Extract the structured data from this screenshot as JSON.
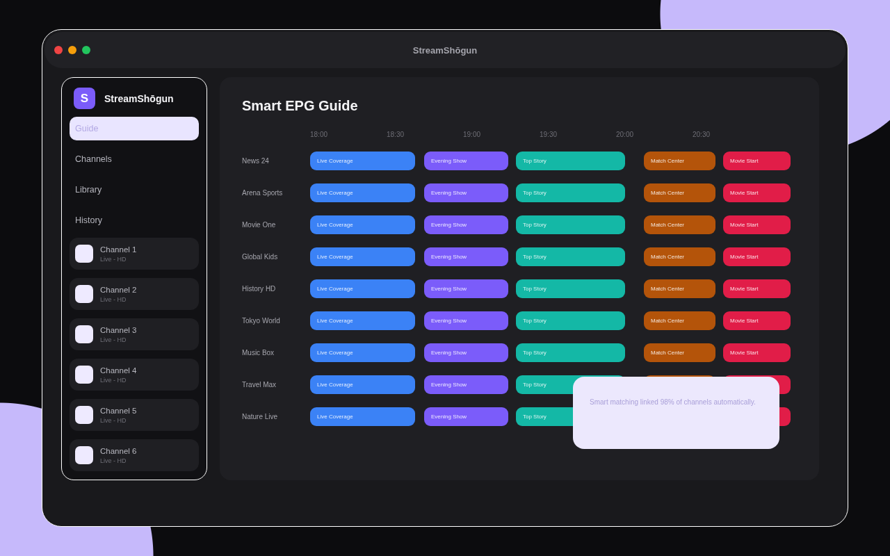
{
  "window": {
    "title": "StreamShōgun"
  },
  "sidebar": {
    "logo": {
      "initial": "S",
      "name": "StreamShōgun"
    },
    "nav": [
      {
        "label": "Guide",
        "selected": true
      },
      {
        "label": "Channels",
        "selected": false
      },
      {
        "label": "Library",
        "selected": false
      },
      {
        "label": "History",
        "selected": false
      }
    ],
    "channels": [
      {
        "name": "Channel 1",
        "status": "Live - HD"
      },
      {
        "name": "Channel 2",
        "status": "Live - HD"
      },
      {
        "name": "Channel 3",
        "status": "Live - HD"
      },
      {
        "name": "Channel 4",
        "status": "Live - HD"
      },
      {
        "name": "Channel 5",
        "status": "Live - HD"
      },
      {
        "name": "Channel 6",
        "status": "Live - HD"
      }
    ]
  },
  "guide": {
    "title": "Smart EPG Guide",
    "times": [
      "18:00",
      "18:30",
      "19:00",
      "19:30",
      "20:00",
      "20:30"
    ],
    "rows": [
      {
        "channel": "News 24",
        "programs": [
          {
            "title": "Live Coverage",
            "color": "#3b82f6"
          },
          {
            "title": "Evening Show",
            "color": "#7b5cfa"
          },
          {
            "title": "Top Story",
            "color": "#14b8a6"
          },
          {
            "title": "Match Center",
            "color": "#b4540a"
          },
          {
            "title": "Movie Start",
            "color": "#e11d48"
          }
        ]
      },
      {
        "channel": "Arena Sports",
        "programs": [
          {
            "title": "Live Coverage",
            "color": "#3b82f6"
          },
          {
            "title": "Evening Show",
            "color": "#7b5cfa"
          },
          {
            "title": "Top Story",
            "color": "#14b8a6"
          },
          {
            "title": "Match Center",
            "color": "#b4540a"
          },
          {
            "title": "Movie Start",
            "color": "#e11d48"
          }
        ]
      },
      {
        "channel": "Movie One",
        "programs": [
          {
            "title": "Live Coverage",
            "color": "#3b82f6"
          },
          {
            "title": "Evening Show",
            "color": "#7b5cfa"
          },
          {
            "title": "Top Story",
            "color": "#14b8a6"
          },
          {
            "title": "Match Center",
            "color": "#b4540a"
          },
          {
            "title": "Movie Start",
            "color": "#e11d48"
          }
        ]
      },
      {
        "channel": "Global Kids",
        "programs": [
          {
            "title": "Live Coverage",
            "color": "#3b82f6"
          },
          {
            "title": "Evening Show",
            "color": "#7b5cfa"
          },
          {
            "title": "Top Story",
            "color": "#14b8a6"
          },
          {
            "title": "Match Center",
            "color": "#b4540a"
          },
          {
            "title": "Movie Start",
            "color": "#e11d48"
          }
        ]
      },
      {
        "channel": "History HD",
        "programs": [
          {
            "title": "Live Coverage",
            "color": "#3b82f6"
          },
          {
            "title": "Evening Show",
            "color": "#7b5cfa"
          },
          {
            "title": "Top Story",
            "color": "#14b8a6"
          },
          {
            "title": "Match Center",
            "color": "#b4540a"
          },
          {
            "title": "Movie Start",
            "color": "#e11d48"
          }
        ]
      },
      {
        "channel": "Tokyo World",
        "programs": [
          {
            "title": "Live Coverage",
            "color": "#3b82f6"
          },
          {
            "title": "Evening Show",
            "color": "#7b5cfa"
          },
          {
            "title": "Top Story",
            "color": "#14b8a6"
          },
          {
            "title": "Match Center",
            "color": "#b4540a"
          },
          {
            "title": "Movie Start",
            "color": "#e11d48"
          }
        ]
      },
      {
        "channel": "Music Box",
        "programs": [
          {
            "title": "Live Coverage",
            "color": "#3b82f6"
          },
          {
            "title": "Evening Show",
            "color": "#7b5cfa"
          },
          {
            "title": "Top Story",
            "color": "#14b8a6"
          },
          {
            "title": "Match Center",
            "color": "#b4540a"
          },
          {
            "title": "Movie Start",
            "color": "#e11d48"
          }
        ]
      },
      {
        "channel": "Travel Max",
        "programs": [
          {
            "title": "Live Coverage",
            "color": "#3b82f6"
          },
          {
            "title": "Evening Show",
            "color": "#7b5cfa"
          },
          {
            "title": "Top Story",
            "color": "#14b8a6"
          },
          {
            "color": "#b4540a"
          },
          {
            "color": "#e11d48"
          }
        ]
      },
      {
        "channel": "Nature Live",
        "programs": [
          {
            "title": "Live Coverage",
            "color": "#3b82f6"
          },
          {
            "title": "Evening Show",
            "color": "#7b5cfa"
          },
          {
            "title": "Top Story",
            "color": "#14b8a6"
          },
          {
            "color": "#e11d48"
          }
        ]
      }
    ]
  },
  "toast": {
    "message": "Smart matching linked 98% of channels automatically."
  }
}
